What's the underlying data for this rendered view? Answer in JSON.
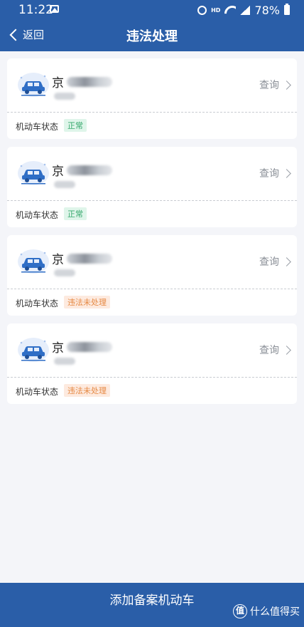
{
  "status_bar": {
    "time": "11:22",
    "hd": "HD",
    "battery": "78%"
  },
  "nav": {
    "back_label": "返回",
    "title": "违法处理"
  },
  "vehicles": [
    {
      "plate_prefix": "京",
      "query_label": "查询",
      "status_label": "机动车状态",
      "status": "正常",
      "status_type": "normal"
    },
    {
      "plate_prefix": "京",
      "query_label": "查询",
      "status_label": "机动车状态",
      "status": "正常",
      "status_type": "normal"
    },
    {
      "plate_prefix": "京",
      "query_label": "查询",
      "status_label": "机动车状态",
      "status": "违法未处理",
      "status_type": "violation"
    },
    {
      "plate_prefix": "京",
      "query_label": "查询",
      "status_label": "机动车状态",
      "status": "违法未处理",
      "status_type": "violation"
    }
  ],
  "add_button_label": "添加备案机动车",
  "watermark": {
    "logo": "值",
    "text": "什么值得买"
  },
  "colors": {
    "primary": "#2a5ea8",
    "normal": "#36a86c",
    "violation": "#e68a45"
  }
}
